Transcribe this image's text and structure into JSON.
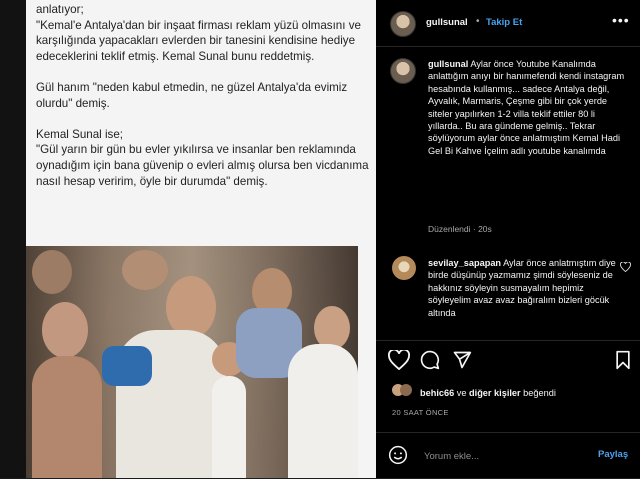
{
  "post": {
    "quote_text": "anlatıyor;\n\"Kemal'e Antalya'dan bir inşaat firması reklam yüzü olmasını ve karşılığında yapacakları evlerden bir tanesini kendisine hediye edeceklerini teklif etmiş. Kemal Sunal bunu reddetmiş.\n\nGül hanım \"neden kabul etmedin, ne güzel Antalya'da evimiz olurdu\" demiş.\n\nKemal Sunal ise;\n\"Gül yarın bir gün bu evler yıkılırsa ve insanlar ben reklamında oynadığım için bana güvenip o evleri almış olursa ben vicdanıma nasıl hesap veririm, öyle bir durumda\" demiş."
  },
  "header": {
    "username": "gullsunal",
    "dot": "•",
    "follow_label": "Takip Et",
    "more_glyph": "•••"
  },
  "caption": {
    "username": "gullsunal",
    "text": " Aylar önce Youtube Kanalımda anlattığım anıyı bir hanımefendi kendi instagram hesabında kullanmış... sadece Antalya değil, Ayvalık, Marmaris, Çeşme gibi bir çok yerde siteler yapılırken 1-2 villa teklif ettiler 80 li yıllarda.. Bu ara gündeme gelmiş.. Tekrar söylüyorum aylar önce anlatmıştım Kemal Hadi Gel Bi Kahve İçelim adlı youtube kanalımda",
    "edited": "Düzenlendi · 20s"
  },
  "comment": {
    "username": "sevilay_sapapan",
    "text": " Aylar önce anlatmıştım diye birde düşünüp yazmamız şimdi söyleseniz de hakkınız söyleyin susmayalım hepimiz söyleyelim avaz avaz bağıralım bizleri göcük altında"
  },
  "likes": {
    "user": "behic66",
    "connector": " ve ",
    "others": "diğer kişiler",
    "suffix": " beğendi"
  },
  "time_ago": "20 SAAT ÖNCE",
  "comment_box": {
    "placeholder": "Yorum ekle...",
    "post_label": "Paylaş"
  },
  "icons": [
    "heart-icon",
    "comment-icon",
    "share-icon",
    "bookmark-icon",
    "emoji-icon",
    "more-icon"
  ],
  "colors": {
    "accent": "#4aa3f0",
    "panel_bg": "#000000",
    "muted": "#a8a8a8"
  }
}
